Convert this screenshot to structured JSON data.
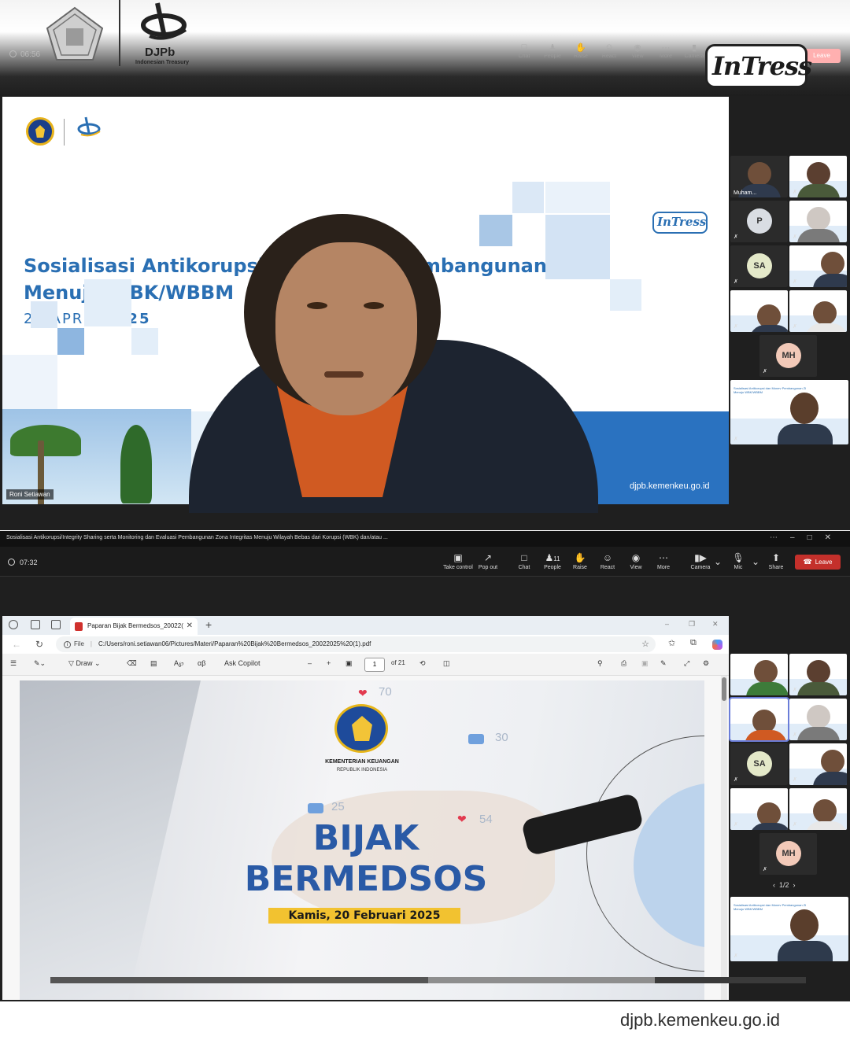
{
  "top_header": {
    "time": "06:56",
    "brand": "DJPb",
    "brand_sub": "Indonesian Treasury",
    "tools": [
      "Chat",
      "People",
      "Raise",
      "React",
      "View",
      "More",
      "Camera"
    ],
    "leave_label": "Leave",
    "overlay_logo": "InTress"
  },
  "slide_1": {
    "brand": "DJPb",
    "brand_sub": "Indonesian Treasury",
    "title": "Sosialisasi Antikorupsi dan Monev Pembangunan ZI Menuju WBK/WBBM",
    "date_prefix": "24 APRIL",
    "date_year": "2025",
    "intress_logo": "InTress",
    "presenter_name": "Roni Setiawan",
    "url": "djpb.kemenkeu.go.id"
  },
  "participants_1": [
    {
      "type": "video",
      "name": "Muham..."
    },
    {
      "type": "video",
      "name": ""
    },
    {
      "type": "avatar",
      "initials": "P",
      "color": "#d9dde3"
    },
    {
      "type": "video",
      "name": ""
    },
    {
      "type": "avatar",
      "initials": "SA",
      "color": "#e4e9c9"
    },
    {
      "type": "video",
      "name": ""
    },
    {
      "type": "video",
      "name": ""
    },
    {
      "type": "video",
      "name": ""
    },
    {
      "type": "avatar",
      "initials": "MH",
      "color": "#f2c9b8"
    },
    {
      "type": "video",
      "name": ""
    }
  ],
  "teams": {
    "window_title": "Sosialisasi Antikorupsi/Integrity Sharing serta Monitoring dan Evaluasi Pembangunan Zona Integritas Menuju Wilayah Bebas dari Korupsi (WBK) dan/atau ...",
    "time": "07:32",
    "toolbar": {
      "take_control": "Take control",
      "pop_out": "Pop out",
      "chat": "Chat",
      "people": "People",
      "people_count": "11",
      "raise": "Raise",
      "react": "React",
      "view": "View",
      "more": "More",
      "camera": "Camera",
      "mic": "Mic",
      "share": "Share",
      "leave": "Leave"
    },
    "pager": "1/2"
  },
  "browser": {
    "tab_title": "Paparan Bijak Bermedsos_20022(",
    "address_scheme": "File",
    "url": "C:/Users/roni.setiawan06/Pictures/Materi/Paparan%20Bijak%20Bermedsos_20022025%20(1).pdf",
    "pdf_toolbar": {
      "draw": "Draw",
      "ask_copilot": "Ask Copilot",
      "page_number": "1",
      "page_total": "of 21"
    }
  },
  "pdf_slide": {
    "org_name": "KEMENTERIAN KEUANGAN",
    "org_sub": "REPUBLIK INDONESIA",
    "title_line1": "BIJAK",
    "title_line2": "BERMEDSOS",
    "date": "Kamis, 20 Februari 2025",
    "reaction_counts": [
      "70",
      "30",
      "25",
      "54"
    ]
  },
  "participants_2": [
    {
      "type": "video",
      "name": ""
    },
    {
      "type": "video",
      "name": ""
    },
    {
      "type": "video",
      "name": ""
    },
    {
      "type": "video",
      "name": ""
    },
    {
      "type": "avatar",
      "initials": "SA",
      "color": "#e4e9c9"
    },
    {
      "type": "video",
      "name": ""
    },
    {
      "type": "video",
      "name": ""
    },
    {
      "type": "video",
      "name": ""
    },
    {
      "type": "avatar",
      "initials": "MH",
      "color": "#f2c9b8"
    },
    {
      "type": "video",
      "name": ""
    }
  ],
  "footer": {
    "url": "djpb.kemenkeu.go.id"
  },
  "colors": {
    "brand_blue": "#2a6fb3",
    "leave_red": "#c4302b",
    "date_yellow": "#f2c230"
  }
}
